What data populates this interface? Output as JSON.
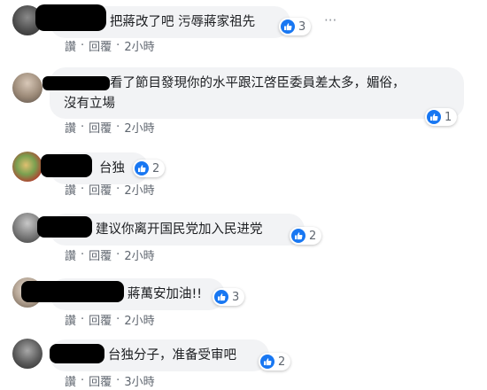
{
  "colors": {
    "bubble": "#f2f3f5",
    "like_blue": "#1877f2",
    "meta_text": "#606770",
    "redaction": "#000000"
  },
  "actions_template": {
    "like_label": "讚",
    "reply_label": "回覆",
    "separator": "·"
  },
  "more_icon": "horizontal-ellipsis",
  "comments": [
    {
      "text": "把蔣改了吧 污辱蔣家祖先",
      "likes": "3",
      "time": "2小時"
    },
    {
      "text_line1": "看了節目發現你的水平跟江啓臣委員差太多，媚俗，",
      "text_line2": "沒有立場",
      "likes": "1",
      "time": "2小時"
    },
    {
      "text": "台独",
      "likes": "2",
      "time": "2小時"
    },
    {
      "text": "建议你离开国民党加入民进党",
      "likes": "2",
      "time": "2小時"
    },
    {
      "text": "蔣萬安加油!!",
      "likes": "3",
      "time": "2小時"
    },
    {
      "text": "台独分子，准备受审吧",
      "likes": "2",
      "time": "3小時"
    }
  ]
}
